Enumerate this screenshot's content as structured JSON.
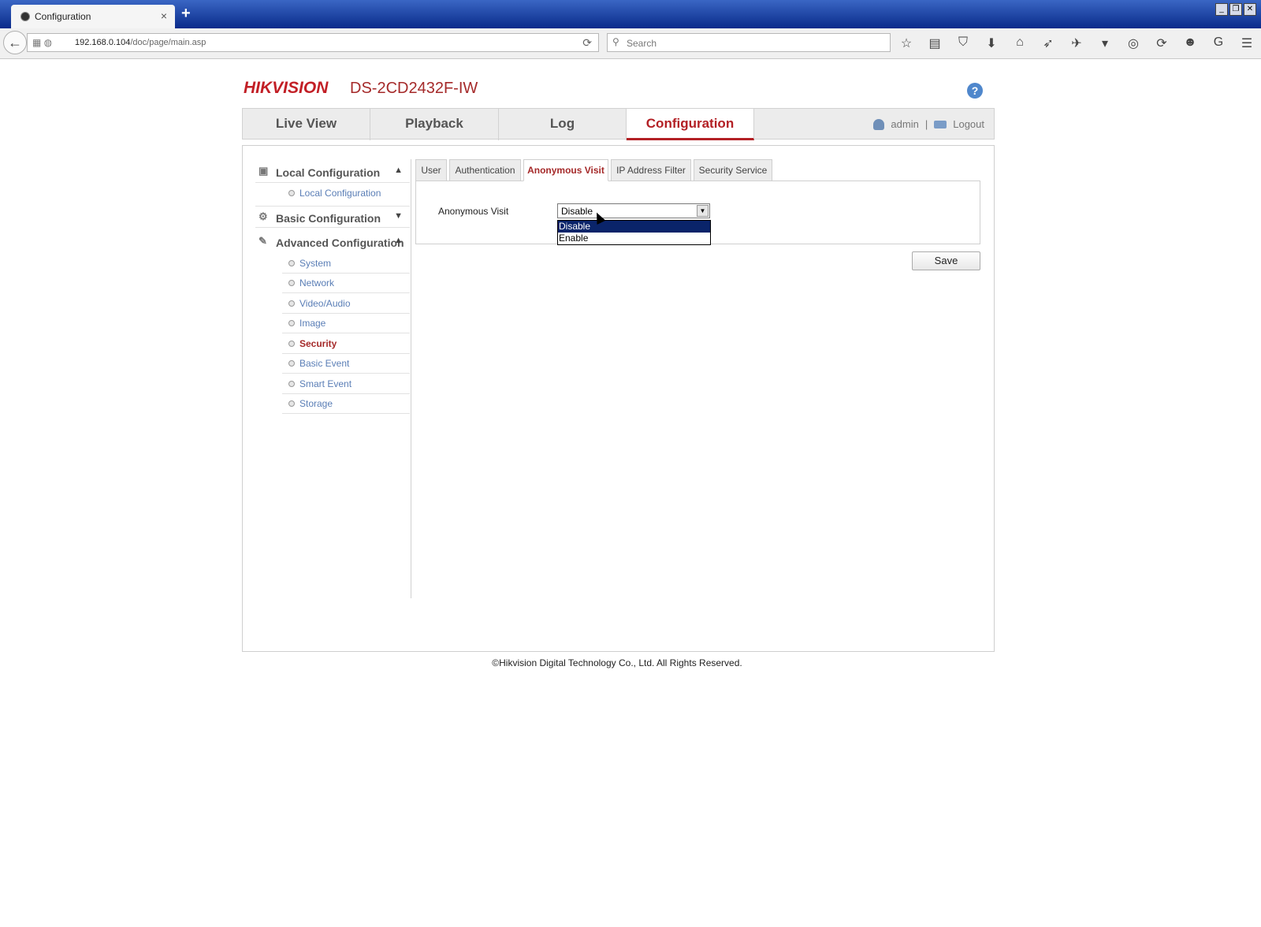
{
  "browser": {
    "tab_title": "Configuration",
    "tab_close": "×",
    "new_tab": "+",
    "url_host": "192.168.0.104",
    "url_path": "/doc/page/main.asp",
    "search_placeholder": "Search",
    "window_buttons": [
      "_",
      "❐",
      "✕"
    ],
    "toolbar_icons": [
      "☆",
      "▤",
      "⛉",
      "⬇",
      "⌂",
      "➶",
      "✈",
      "▾",
      "◎",
      "⟳",
      "☻",
      "G",
      "☰"
    ]
  },
  "header": {
    "brand_hik": "HIK",
    "brand_vision": "VISION",
    "model": "DS-2CD2432F-IW",
    "help": "?"
  },
  "nav": {
    "items": [
      "Live View",
      "Playback",
      "Log",
      "Configuration"
    ],
    "active": "Configuration",
    "user": "admin",
    "separator": "|",
    "logout": "Logout"
  },
  "sidebar": {
    "local": {
      "label": "Local Configuration",
      "items": [
        "Local Configuration"
      ]
    },
    "basic": {
      "label": "Basic Configuration"
    },
    "advanced": {
      "label": "Advanced Configuration",
      "items": [
        "System",
        "Network",
        "Video/Audio",
        "Image",
        "Security",
        "Basic Event",
        "Smart Event",
        "Storage"
      ],
      "active": "Security"
    }
  },
  "tabs": {
    "items": [
      "User",
      "Authentication",
      "Anonymous Visit",
      "IP Address Filter",
      "Security Service"
    ],
    "active": "Anonymous Visit"
  },
  "form": {
    "label": "Anonymous Visit",
    "selected": "Disable",
    "options": [
      "Disable",
      "Enable"
    ],
    "save": "Save"
  },
  "footer": "©Hikvision Digital Technology Co., Ltd. All Rights Reserved."
}
